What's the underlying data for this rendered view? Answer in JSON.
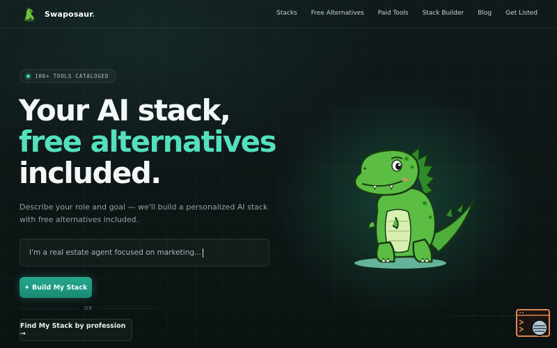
{
  "brand": {
    "name": "Swaposaur",
    "dot": "."
  },
  "nav": {
    "links": [
      "Stacks",
      "Free Alternatives",
      "Paid Tools",
      "Stack Builder",
      "Blog",
      "Get Listed"
    ]
  },
  "hero": {
    "badge": "100+ TOOLS CATALOGED",
    "headline_line1": "Your AI stack,",
    "headline_line2": "free alternatives",
    "headline_line3": "included.",
    "subtitle": "Describe your role and goal — we'll build a personalized AI stack with free alternatives included.",
    "input_value": "I'm a real estate agent focused on marketing...",
    "build_button": "✦ Build My Stack",
    "or_text": "OR",
    "profession_button": "Find My Stack by profession →"
  },
  "colors": {
    "background": "#0c1414",
    "accent": "#54e0bd",
    "button": "#1f9a80"
  },
  "icons": {
    "logo": "dino-logo-icon",
    "mascot": "dinosaur-mascot",
    "chat": "chat-widget-icon"
  }
}
